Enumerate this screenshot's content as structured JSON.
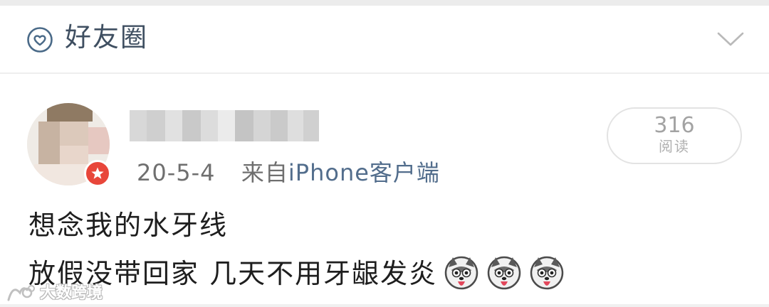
{
  "header": {
    "title": "好友圈",
    "icon": "heart-circle-icon",
    "expand_icon": "chevron-down-icon"
  },
  "post": {
    "date": "20-5-4",
    "source_prefix": "来自",
    "source": "iPhone客户端",
    "read_count": "316",
    "read_label": "阅读",
    "line1": "想念我的水牙线",
    "line2": "放假没带回家 几天不用牙龈发炎",
    "emoji": "husky-face-emoji",
    "emoji_count": 3
  },
  "watermark": {
    "text": "大数跨境",
    "icon": "brand-logo-icon"
  },
  "colors": {
    "header_text": "#3f4f61",
    "source_link": "#526d8c",
    "badge": "#e8463a"
  }
}
